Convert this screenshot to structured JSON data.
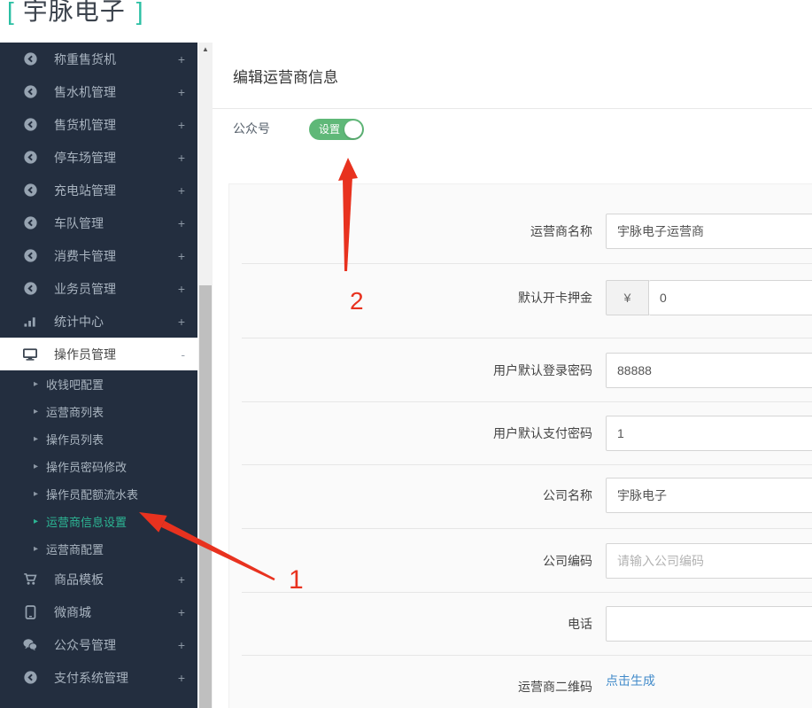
{
  "brand": {
    "bracket_left": "[",
    "name": "宇脉电子",
    "bracket_right": "]"
  },
  "sidebar": {
    "items": [
      {
        "label": "称重售货机",
        "icon": "circle-arrow-left-icon",
        "suffix": "+"
      },
      {
        "label": "售水机管理",
        "icon": "circle-arrow-left-icon",
        "suffix": "+"
      },
      {
        "label": "售货机管理",
        "icon": "circle-arrow-left-icon",
        "suffix": "+"
      },
      {
        "label": "停车场管理",
        "icon": "circle-arrow-left-icon",
        "suffix": "+"
      },
      {
        "label": "充电站管理",
        "icon": "circle-arrow-left-icon",
        "suffix": "+"
      },
      {
        "label": "车队管理",
        "icon": "circle-arrow-left-icon",
        "suffix": "+"
      },
      {
        "label": "消费卡管理",
        "icon": "circle-arrow-left-icon",
        "suffix": "+"
      },
      {
        "label": "业务员管理",
        "icon": "circle-arrow-left-icon",
        "suffix": "+"
      },
      {
        "label": "统计中心",
        "icon": "bar-chart-icon",
        "suffix": "+"
      },
      {
        "label": "操作员管理",
        "icon": "desktop-icon",
        "suffix": "-",
        "active": true
      },
      {
        "label": "商品模板",
        "icon": "cart-icon",
        "suffix": "+"
      },
      {
        "label": "微商城",
        "icon": "mobile-icon",
        "suffix": "+"
      },
      {
        "label": "公众号管理",
        "icon": "wechat-icon",
        "suffix": "+"
      },
      {
        "label": "支付系统管理",
        "icon": "circle-arrow-left-icon",
        "suffix": "+"
      }
    ],
    "submenu": [
      {
        "label": "收钱吧配置"
      },
      {
        "label": "运营商列表"
      },
      {
        "label": "操作员列表"
      },
      {
        "label": "操作员密码修改"
      },
      {
        "label": "操作员配额流水表"
      },
      {
        "label": "运营商信息设置",
        "active": true
      },
      {
        "label": "运营商配置"
      }
    ]
  },
  "page": {
    "title": "编辑运营商信息"
  },
  "public_account": {
    "label": "公众号",
    "toggle_label": "设置",
    "state": "on"
  },
  "form": {
    "fields": [
      {
        "label": "运营商名称",
        "value": "宇脉电子运营商"
      },
      {
        "label": "默认开卡押金",
        "prefix": "¥",
        "value": "0"
      },
      {
        "label": "用户默认登录密码",
        "value": "88888"
      },
      {
        "label": "用户默认支付密码",
        "value": "1"
      },
      {
        "label": "公司名称",
        "value": "宇脉电子"
      },
      {
        "label": "公司编码",
        "value": "",
        "placeholder": "请输入公司编码"
      },
      {
        "label": "电话",
        "value": ""
      },
      {
        "label": "运营商二维码",
        "link": "点击生成"
      }
    ]
  },
  "annotations": {
    "step1": "1",
    "step2": "2"
  },
  "glyphs": {
    "plus_1": "+",
    "minus": "-",
    "caret": "▸",
    "scroll_up": "▲"
  },
  "colors": {
    "accent_teal": "#2cb694",
    "toggle_green": "#5FB878",
    "link_blue": "#428bca",
    "arrow_red": "#e8321f",
    "sidebar_bg": "#232e3f"
  }
}
